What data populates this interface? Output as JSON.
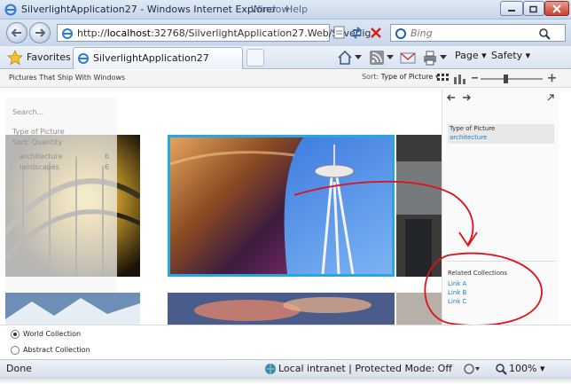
{
  "window": {
    "title": "SilverlightApplication27 - Windows Internet Explorer",
    "menu_hint_1": "Window",
    "menu_hint_2": "Help"
  },
  "navigation": {
    "url_prefix": "http://",
    "url_host": "localhost",
    "url_rest": ":32768/SilverlightApplication27.Web/Silverlig",
    "search_placeholder": "Bing"
  },
  "favorites": {
    "favorites_label": "Favorites",
    "tab_label": "SilverlightApplication27",
    "page_label": "Page",
    "safety_label": "Safety"
  },
  "app": {
    "caption": "Pictures That Ship With Windows",
    "sort_label": "Sort:",
    "sort_value": "Type of Picture",
    "filter": {
      "search_placeholder": "Search...",
      "category": "Type of Picture",
      "sort": "Sort: Quantity",
      "items": [
        {
          "label": "architecture",
          "count": "6"
        },
        {
          "label": "landscapes",
          "count": "6"
        }
      ]
    },
    "info": {
      "facet_name": "Type of Picture",
      "facet_value": "architecture",
      "related_title": "Related Collections",
      "links": [
        "Link A",
        "Link B",
        "Link C"
      ]
    },
    "collections": [
      "World Collection",
      "Abstract Collection"
    ],
    "selected_collection": "World Collection"
  },
  "status": {
    "left": "Done",
    "zone": "Local intranet | Protected Mode: Off",
    "zoom": "100%"
  },
  "colors": {
    "accent": "#1a7fc4",
    "annotation": "#e0101a",
    "selection_border": "#27a7e0"
  }
}
